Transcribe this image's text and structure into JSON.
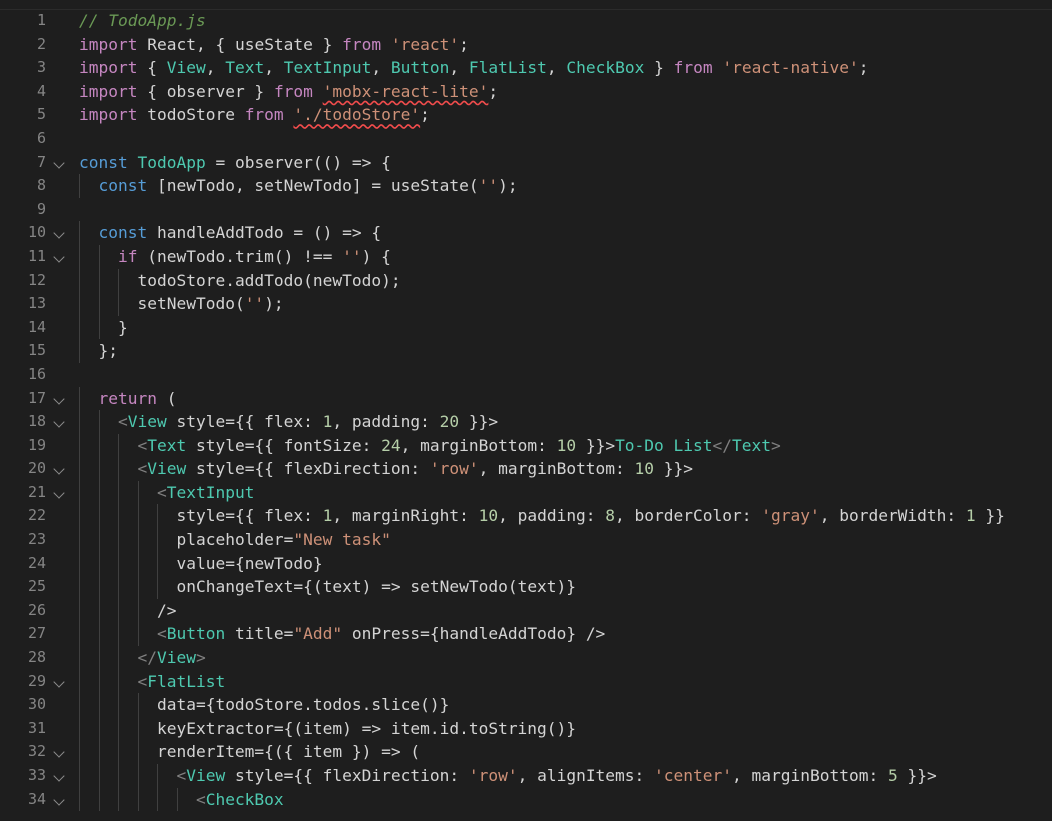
{
  "editor": {
    "file_comment": "// TodoApp.js",
    "lines": [
      {
        "n": "1"
      },
      {
        "n": "2"
      },
      {
        "n": "3"
      },
      {
        "n": "4"
      },
      {
        "n": "5"
      },
      {
        "n": "6"
      },
      {
        "n": "7"
      },
      {
        "n": "8"
      },
      {
        "n": "9"
      },
      {
        "n": "10"
      },
      {
        "n": "11"
      },
      {
        "n": "12"
      },
      {
        "n": "13"
      },
      {
        "n": "14"
      },
      {
        "n": "15"
      },
      {
        "n": "16"
      },
      {
        "n": "17"
      },
      {
        "n": "18"
      },
      {
        "n": "19"
      },
      {
        "n": "20"
      },
      {
        "n": "21"
      },
      {
        "n": "22"
      },
      {
        "n": "23"
      },
      {
        "n": "24"
      },
      {
        "n": "25"
      },
      {
        "n": "26"
      },
      {
        "n": "27"
      },
      {
        "n": "28"
      },
      {
        "n": "29"
      },
      {
        "n": "30"
      },
      {
        "n": "31"
      },
      {
        "n": "32"
      },
      {
        "n": "33"
      },
      {
        "n": "34"
      }
    ],
    "code": {
      "l2": [
        "import",
        " React, { ",
        "useState",
        " } ",
        "from",
        " ",
        "'react'",
        ";"
      ],
      "l3": [
        "import",
        " { ",
        "View",
        ", ",
        "Text",
        ", ",
        "TextInput",
        ", ",
        "Button",
        ", ",
        "FlatList",
        ", ",
        "CheckBox",
        " } ",
        "from",
        " ",
        "'react-native'",
        ";"
      ],
      "l4": [
        "import",
        " { observer } ",
        "from",
        " ",
        "'mobx-react-lite'",
        ";"
      ],
      "l5": [
        "import",
        " todoStore ",
        "from",
        " ",
        "'./todoStore'",
        ";"
      ],
      "l7": [
        "const",
        " ",
        "TodoApp",
        " = observer(() => {"
      ],
      "l8": [
        "const",
        " [newTodo, setNewTodo] = useState(",
        "''",
        ");"
      ],
      "l10": [
        "const",
        " handleAddTodo = () => {"
      ],
      "l11": [
        "if",
        " (newTodo.trim() !== ",
        "''",
        ") {"
      ],
      "l12": [
        "todoStore.addTodo(newTodo);"
      ],
      "l13": [
        "setNewTodo(",
        "''",
        ");"
      ],
      "l14": [
        "}"
      ],
      "l15": [
        "};"
      ],
      "l17": [
        "return",
        " ("
      ],
      "l18": [
        "<",
        "View",
        " style={{ flex: ",
        "1",
        ", padding: ",
        "20",
        " }}>"
      ],
      "l19": [
        "<",
        "Text",
        " style={{ fontSize: ",
        "24",
        ", marginBottom: ",
        "10",
        " }}>",
        "To-Do List",
        "</",
        "Text",
        ">"
      ],
      "l20": [
        "<",
        "View",
        " style={{ flexDirection: ",
        "'row'",
        ", marginBottom: ",
        "10",
        " }}>"
      ],
      "l21": [
        "<",
        "TextInput"
      ],
      "l22": [
        "style={{ flex: ",
        "1",
        ", marginRight: ",
        "10",
        ", padding: ",
        "8",
        ", borderColor: ",
        "'gray'",
        ", borderWidth: ",
        "1",
        " }}"
      ],
      "l23": [
        "placeholder=",
        "\"New task\""
      ],
      "l24": [
        "value={newTodo}"
      ],
      "l25": [
        "onChangeText={(text) => setNewTodo(text)}"
      ],
      "l26": [
        "/>"
      ],
      "l27": [
        "<",
        "Button",
        " title=",
        "\"Add\"",
        " onPress={handleAddTodo} />"
      ],
      "l28": [
        "</",
        "View",
        ">"
      ],
      "l29": [
        "<",
        "FlatList"
      ],
      "l30": [
        "data={todoStore.todos.slice()}"
      ],
      "l31": [
        "keyExtractor={(item) => item.id.toString()}"
      ],
      "l32": [
        "renderItem={({ item }) => ("
      ],
      "l33": [
        "<",
        "View",
        " style={{ flexDirection: ",
        "'row'",
        ", alignItems: ",
        "'center'",
        ", marginBottom: ",
        "5",
        " }}>"
      ],
      "l34": [
        "<",
        "CheckBox"
      ]
    }
  },
  "colors": {
    "background": "#1e1e1e",
    "keyword": "#c586c0",
    "storage": "#569cd6",
    "string": "#ce9178",
    "type": "#4ec9b0",
    "number": "#b5cea8",
    "comment": "#6a9955",
    "line_number": "#858585"
  }
}
